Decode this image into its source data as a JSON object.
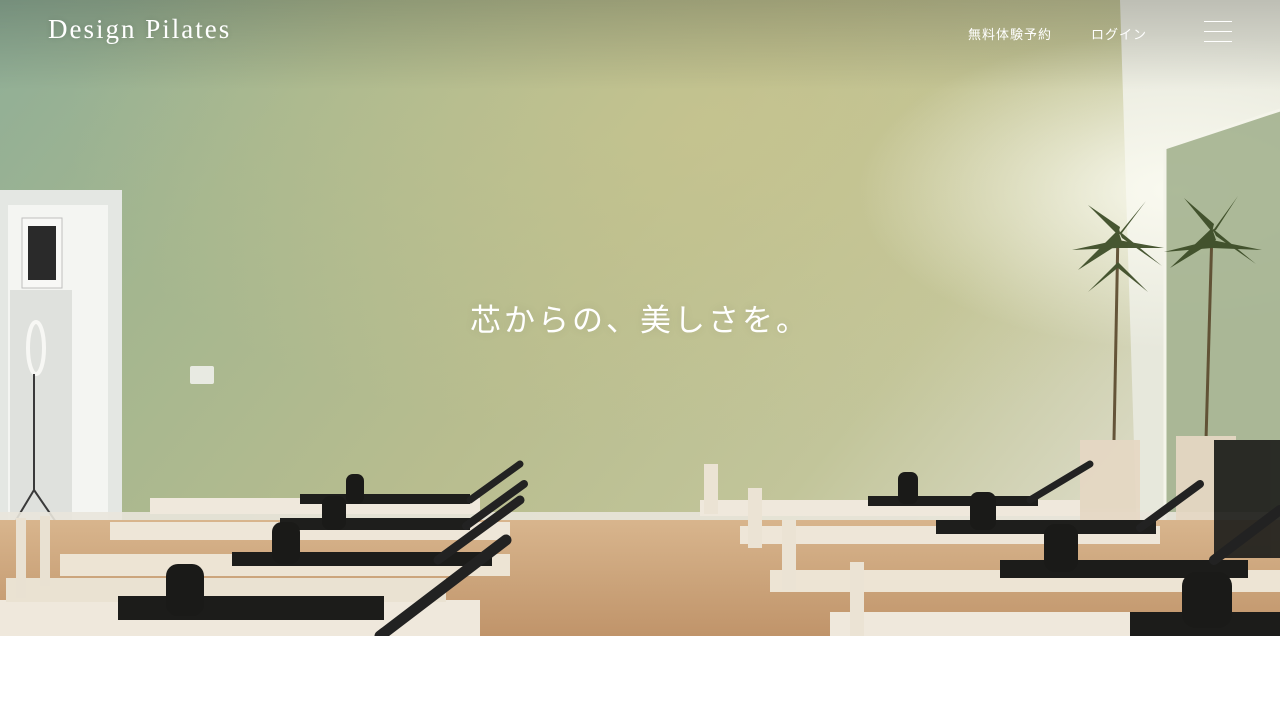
{
  "header": {
    "logo": "Design Pilates",
    "nav": {
      "trial_label": "無料体験予約",
      "login_label": "ログイン"
    },
    "menu_icon": "hamburger-menu-icon"
  },
  "hero": {
    "tagline": "芯からの、美しさを。",
    "image": "pilates-studio-photo"
  },
  "colors": {
    "wall": "#a9b98c",
    "floor": "#caa27a",
    "text": "#ffffff",
    "machine_frame": "#efe8dc",
    "machine_carriage": "#1f1f1d"
  }
}
